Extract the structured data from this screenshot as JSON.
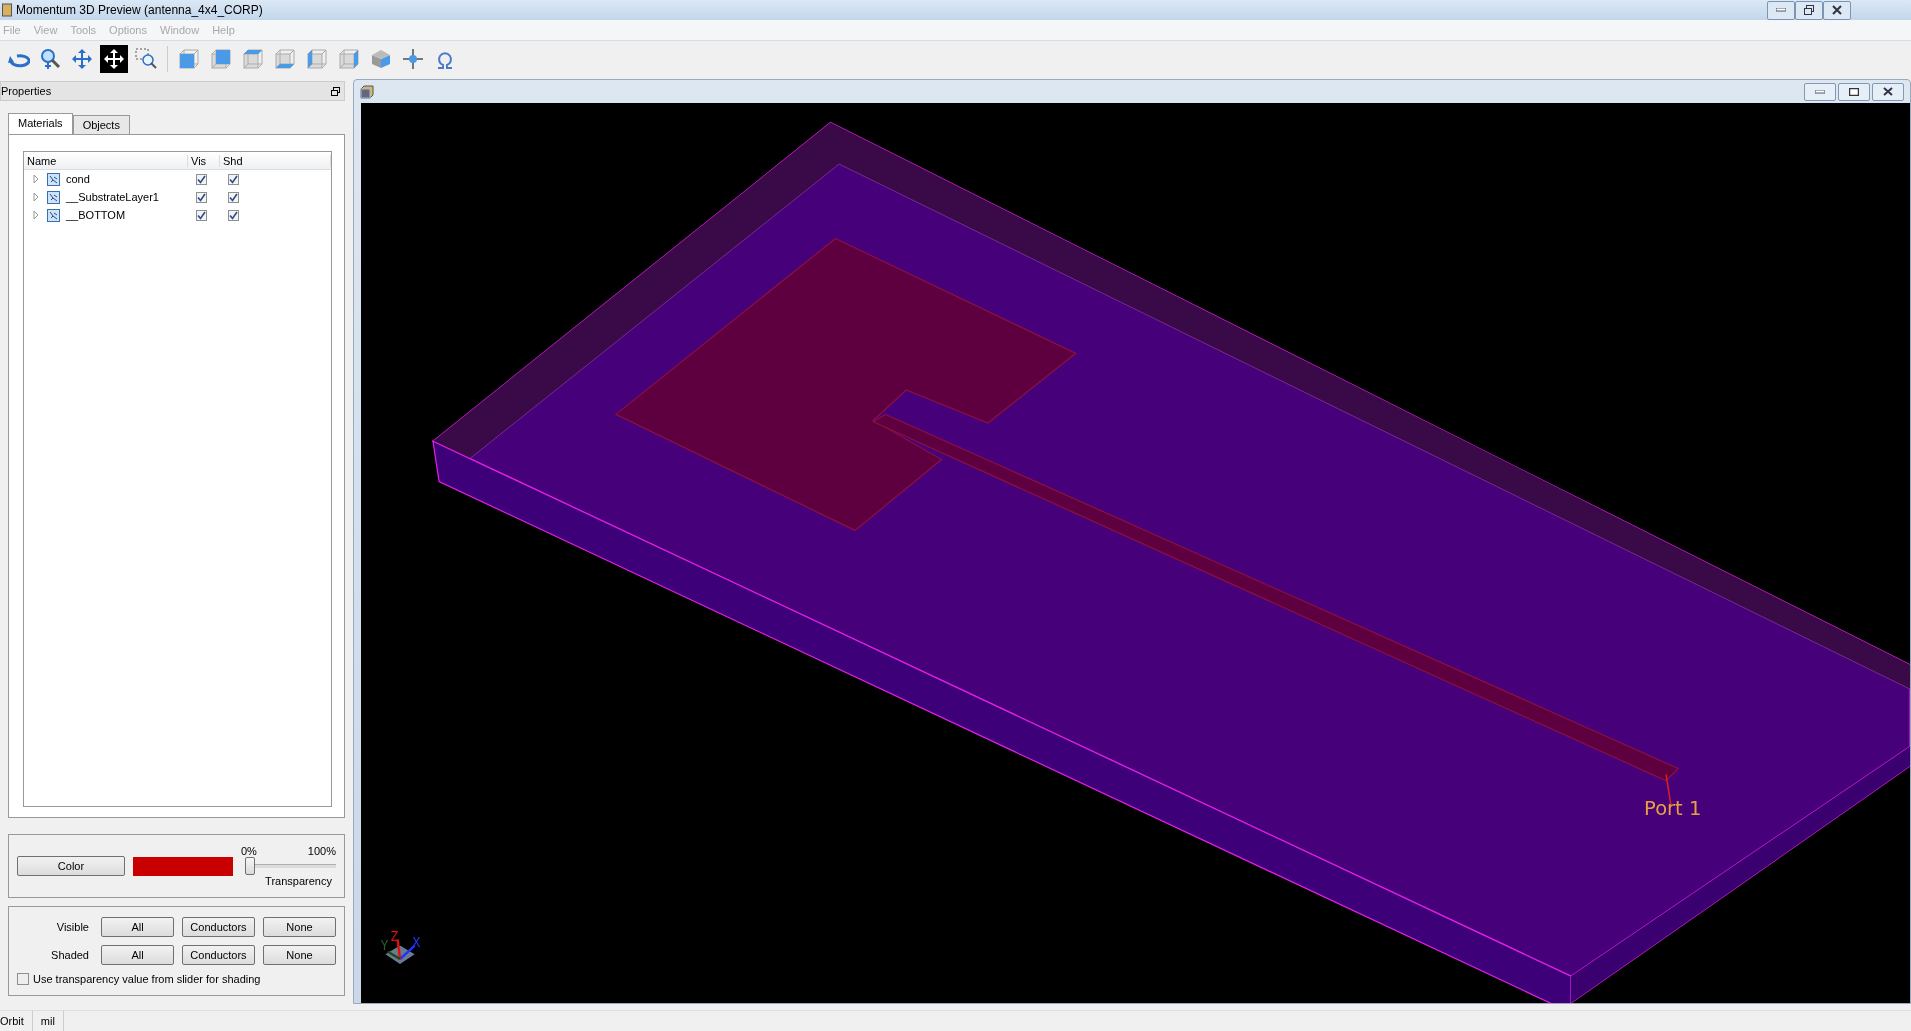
{
  "window": {
    "title": "Momentum 3D Preview (antenna_4x4_CORP)"
  },
  "menu": [
    {
      "label": "File",
      "disabled": true
    },
    {
      "label": "View",
      "disabled": true
    },
    {
      "label": "Tools",
      "disabled": true
    },
    {
      "label": "Options",
      "disabled": true
    },
    {
      "label": "Window",
      "disabled": true
    },
    {
      "label": "Help",
      "disabled": true
    }
  ],
  "toolbar": [
    {
      "kind": "orbit",
      "selected": false
    },
    {
      "kind": "zoom",
      "selected": false
    },
    {
      "kind": "pan",
      "selected": false
    },
    {
      "kind": "move",
      "selected": true
    },
    {
      "kind": "zoom-box",
      "selected": false
    },
    {
      "kind": "cube-front",
      "selected": false
    },
    {
      "kind": "cube-back",
      "selected": false
    },
    {
      "kind": "cube-top",
      "selected": false
    },
    {
      "kind": "cube-bottom",
      "selected": false
    },
    {
      "kind": "cube-left",
      "selected": false
    },
    {
      "kind": "cube-right",
      "selected": false
    },
    {
      "kind": "cube-iso",
      "selected": false
    },
    {
      "kind": "crosshair",
      "selected": false
    },
    {
      "kind": "omega",
      "selected": false
    }
  ],
  "properties": {
    "title": "Properties",
    "tabs": [
      {
        "label": "Materials",
        "selected": true
      },
      {
        "label": "Objects",
        "selected": false
      }
    ],
    "tree": {
      "columns": [
        "Name",
        "Vis",
        "Shd"
      ],
      "rows": [
        {
          "name": "cond",
          "expanded": false,
          "vis": true,
          "shd": true
        },
        {
          "name": "__SubstrateLayer1",
          "expanded": false,
          "vis": true,
          "shd": true
        },
        {
          "name": "__BOTTOM",
          "expanded": false,
          "vis": true,
          "shd": true
        }
      ]
    },
    "material": {
      "button": "Color",
      "color": "#c80000",
      "slider": {
        "min_label": "0%",
        "max_label": "100%",
        "caption": "Transparency",
        "level": 0
      }
    },
    "visibility": {
      "rows": [
        {
          "label": "Visible",
          "buttons": [
            "All",
            "Conductors",
            "None"
          ]
        },
        {
          "label": "Shaded",
          "buttons": [
            "All",
            "Conductors",
            "None"
          ]
        }
      ],
      "checkbox": {
        "label": "Use transparency value from slider for shading",
        "checked": false
      }
    }
  },
  "viewport": {
    "port_label": "Port 1",
    "axis_labels": [
      "Y",
      "Z",
      "X"
    ]
  },
  "status_bar": [
    "Orbit",
    "mil"
  ]
}
